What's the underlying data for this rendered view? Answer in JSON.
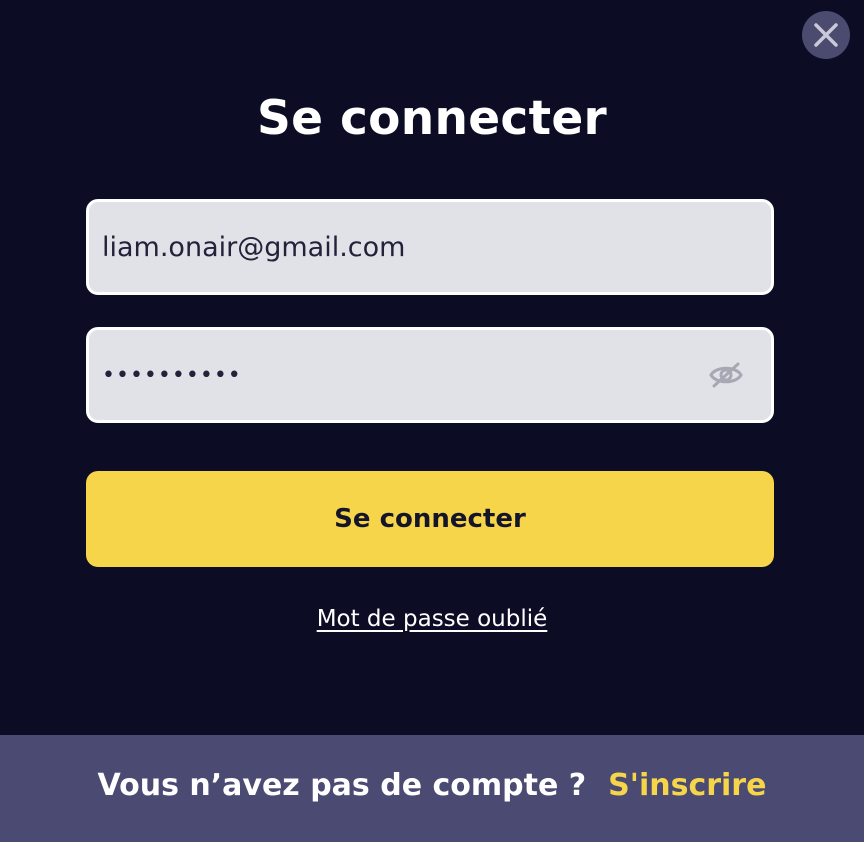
{
  "modal": {
    "title": "Se connecter",
    "close_icon": "close-icon"
  },
  "form": {
    "email_value": "liam.onair@gmail.com",
    "password_value": "••••••••••",
    "password_toggle_icon": "eye-slash-icon",
    "submit_label": "Se connecter",
    "forgot_password_label": "Mot de passe oublié"
  },
  "footer": {
    "prompt": "Vous n’avez pas de compte ?",
    "signup_label": "S'inscrire"
  },
  "colors": {
    "background": "#0c0d24",
    "accent": "#f6d54a",
    "footer_background": "#4b4a73",
    "input_background": "#e1e1e8"
  }
}
